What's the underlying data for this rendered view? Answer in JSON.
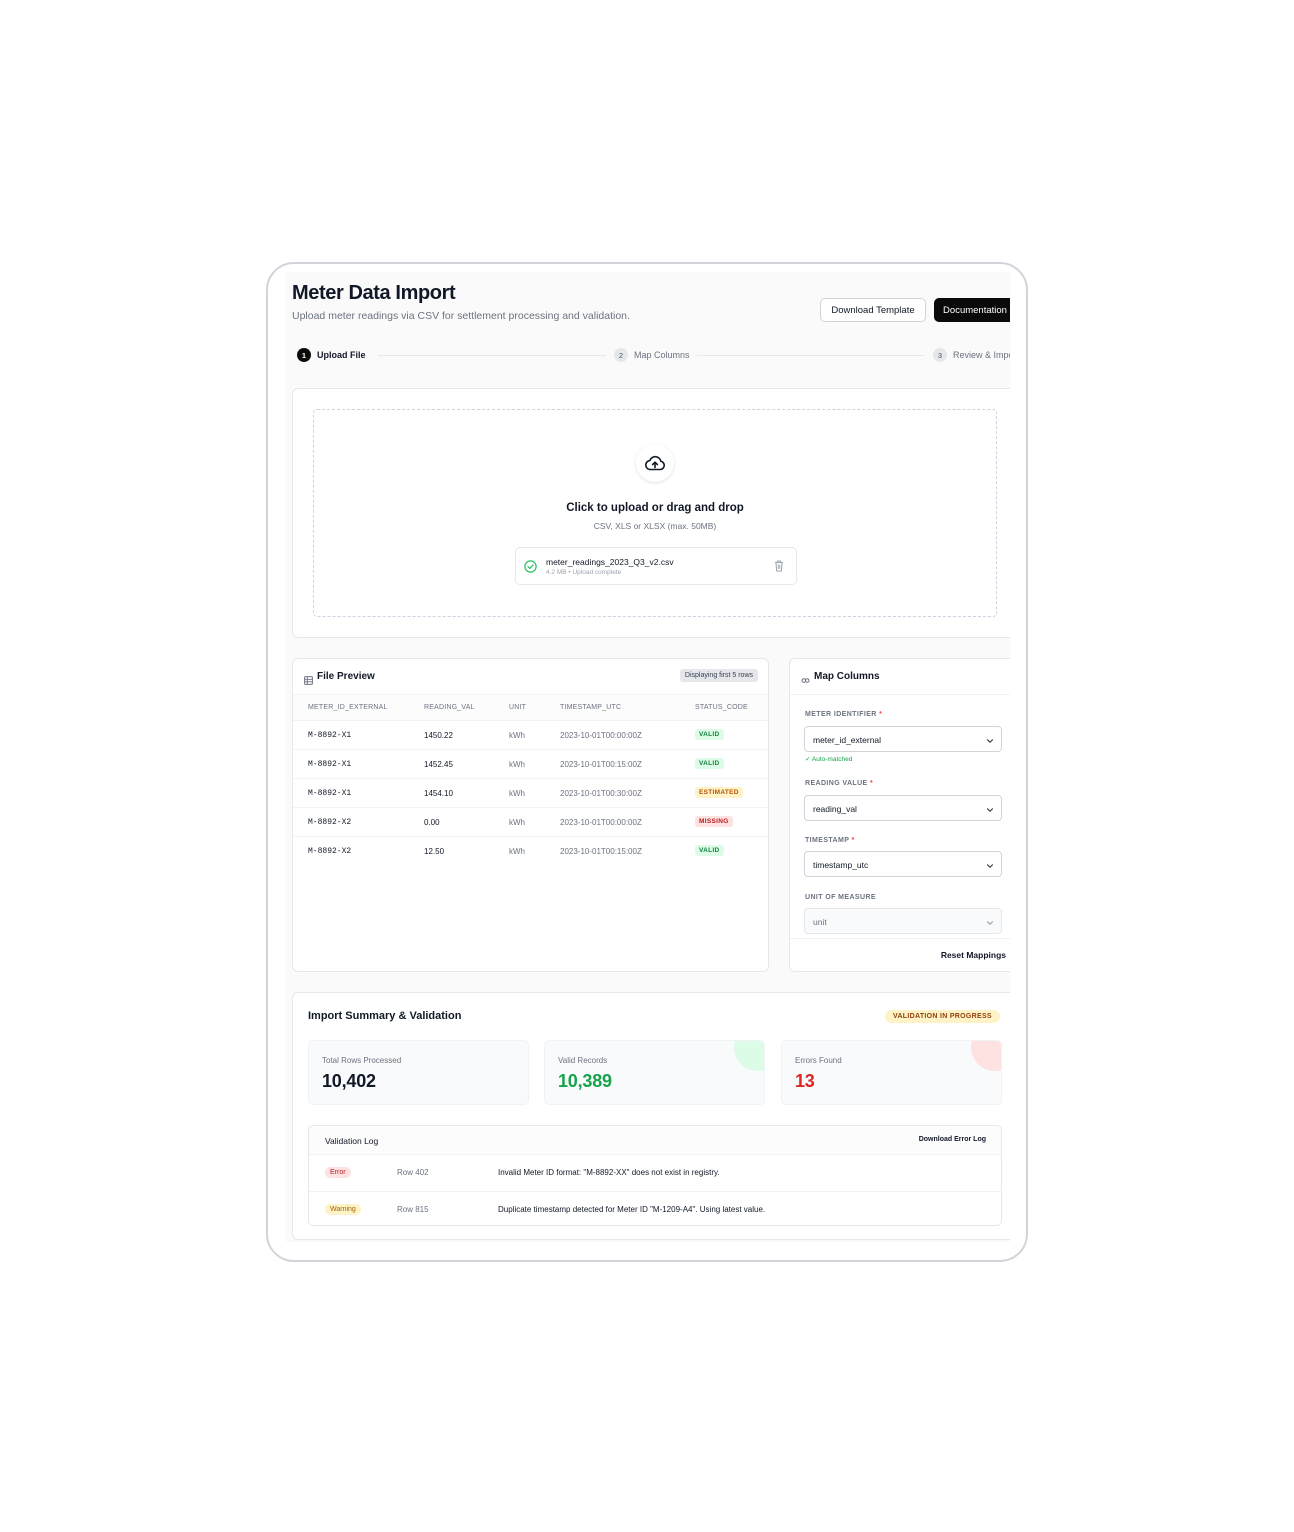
{
  "header": {
    "title": "Meter Data Import",
    "subtitle": "Upload meter readings via CSV for settlement processing and validation.",
    "download_template_label": "Download Template",
    "documentation_label": "Documentation"
  },
  "stepper": [
    {
      "num": "1",
      "label": "Upload File",
      "active": true
    },
    {
      "num": "2",
      "label": "Map Columns",
      "active": false
    },
    {
      "num": "3",
      "label": "Review & Import",
      "active": false
    }
  ],
  "upload": {
    "title": "Click to upload or drag and drop",
    "hint": "CSV, XLS or XLSX (max. 50MB)",
    "file_name": "meter_readings_2023_Q3_v2.csv",
    "file_meta": "4.2 MB • Upload complete"
  },
  "preview": {
    "title": "File Preview",
    "badge": "Displaying first 5 rows",
    "columns": [
      "METER_ID_EXTERNAL",
      "READING_VAL",
      "UNIT",
      "TIMESTAMP_UTC",
      "STATUS_CODE"
    ],
    "rows": [
      {
        "meter": "M-8892-X1",
        "reading": "1450.22",
        "unit": "kWh",
        "ts": "2023-10-01T00:00:00Z",
        "status": "VALID"
      },
      {
        "meter": "M-8892-X1",
        "reading": "1452.45",
        "unit": "kWh",
        "ts": "2023-10-01T00:15:00Z",
        "status": "VALID"
      },
      {
        "meter": "M-8892-X1",
        "reading": "1454.10",
        "unit": "kWh",
        "ts": "2023-10-01T00:30:00Z",
        "status": "ESTIMATED"
      },
      {
        "meter": "M-8892-X2",
        "reading": "0.00",
        "unit": "kWh",
        "ts": "2023-10-01T00:00:00Z",
        "status": "MISSING"
      },
      {
        "meter": "M-8892-X2",
        "reading": "12.50",
        "unit": "kWh",
        "ts": "2023-10-01T00:15:00Z",
        "status": "VALID"
      }
    ]
  },
  "mapping": {
    "title": "Map Columns",
    "fields": [
      {
        "label": "METER IDENTIFIER",
        "required": "*",
        "value": "meter_id_external"
      },
      {
        "label": "READING VALUE",
        "required": "*",
        "value": "reading_val"
      },
      {
        "label": "TIMESTAMP",
        "required": "*",
        "value": "timestamp_utc"
      },
      {
        "label": "UNIT OF MEASURE",
        "required": "",
        "value": "unit"
      }
    ],
    "auto_matched": "✓ Auto-matched",
    "reset_label": "Reset Mappings"
  },
  "summary": {
    "title": "Import Summary & Validation",
    "status_badge": "VALIDATION IN PROGRESS",
    "stats": [
      {
        "label": "Total Rows Processed",
        "value": "10,402"
      },
      {
        "label": "Valid Records",
        "value": "10,389"
      },
      {
        "label": "Errors Found",
        "value": "13"
      }
    ],
    "log": {
      "title": "Validation Log",
      "download_label": "Download Error Log",
      "entries": [
        {
          "level": "Error",
          "row": "Row 402",
          "message": "Invalid Meter ID format: \"M-8892-XX\" does not exist in registry."
        },
        {
          "level": "Warning",
          "row": "Row 815",
          "message": "Duplicate timestamp detected for Meter ID \"M-1209-A4\". Using latest value."
        }
      ]
    }
  },
  "colors": {
    "primary": "#0a0a0a",
    "valid": "#16a34a",
    "error": "#dc2626",
    "warning": "#ca8a04"
  }
}
